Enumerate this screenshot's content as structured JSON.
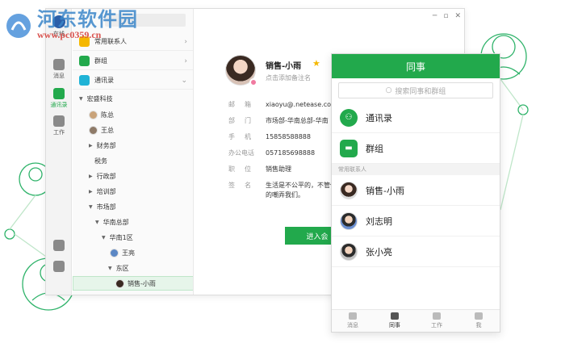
{
  "watermark": {
    "title": "河东软件园",
    "url": "www.pc0359.cn"
  },
  "rail": {
    "status": "在线",
    "items": [
      {
        "label": "消息",
        "icon": "message-icon"
      },
      {
        "label": "通讯录",
        "icon": "contacts-icon"
      },
      {
        "label": "工作",
        "icon": "apps-icon"
      }
    ]
  },
  "tree": {
    "sections": [
      {
        "label": "常用联系人",
        "icon": "star-icon",
        "color": "#f5b800"
      },
      {
        "label": "群组",
        "icon": "group-icon",
        "color": "#22a94c"
      },
      {
        "label": "通讯录",
        "icon": "contacts-icon",
        "color": "#1fb3d6"
      }
    ],
    "nodes": [
      {
        "label": "宏盛科技",
        "type": "dept",
        "expanded": true
      },
      {
        "label": "陈总",
        "type": "person"
      },
      {
        "label": "王总",
        "type": "person"
      },
      {
        "label": "财务部",
        "type": "dept",
        "expanded": false
      },
      {
        "label": "税务",
        "type": "leaf"
      },
      {
        "label": "行政部",
        "type": "dept",
        "expanded": false
      },
      {
        "label": "培训部",
        "type": "dept",
        "expanded": false
      },
      {
        "label": "市场部",
        "type": "dept",
        "expanded": true
      },
      {
        "label": "华南总部",
        "type": "dept",
        "expanded": true
      },
      {
        "label": "华南1区",
        "type": "dept",
        "expanded": true
      },
      {
        "label": "王亮",
        "type": "person"
      },
      {
        "label": "东区",
        "type": "dept",
        "expanded": true
      },
      {
        "label": "销售-小雨",
        "type": "person",
        "selected": true
      }
    ]
  },
  "detail": {
    "name": "销售-小雨",
    "note_placeholder": "点击添加备注名",
    "fields": [
      {
        "key": "邮　箱",
        "value": "xiaoyu@.netease.com"
      },
      {
        "key": "部　门",
        "value": "市场部-华南总部-华南"
      },
      {
        "key": "手　机",
        "value": "15858588888"
      },
      {
        "key": "办公电话",
        "value": "057185698888"
      },
      {
        "key": "职　位",
        "value": "销售助理"
      },
      {
        "key": "签　名",
        "value": "生活是不公平的，不管你的嘲弄我们。"
      }
    ],
    "enter_button": "进入会"
  },
  "panel": {
    "title": "同事",
    "search_placeholder": "搜索同事和群组",
    "entries": [
      {
        "label": "通讯录",
        "icon": "contacts-icon",
        "color": "#22a94c"
      },
      {
        "label": "群组",
        "icon": "group-icon",
        "color": "#22a94c"
      }
    ],
    "section_label": "常用联系人",
    "contacts": [
      {
        "name": "销售-小雨"
      },
      {
        "name": "刘志明"
      },
      {
        "name": "张小亮"
      }
    ],
    "tabs": [
      {
        "label": "消息",
        "icon": "message-icon"
      },
      {
        "label": "同事",
        "icon": "contacts-icon",
        "active": true
      },
      {
        "label": "工作",
        "icon": "apps-icon"
      },
      {
        "label": "我",
        "icon": "profile-icon"
      }
    ]
  },
  "colors": {
    "brand": "#22a94c",
    "accent_star": "#f5b800"
  }
}
